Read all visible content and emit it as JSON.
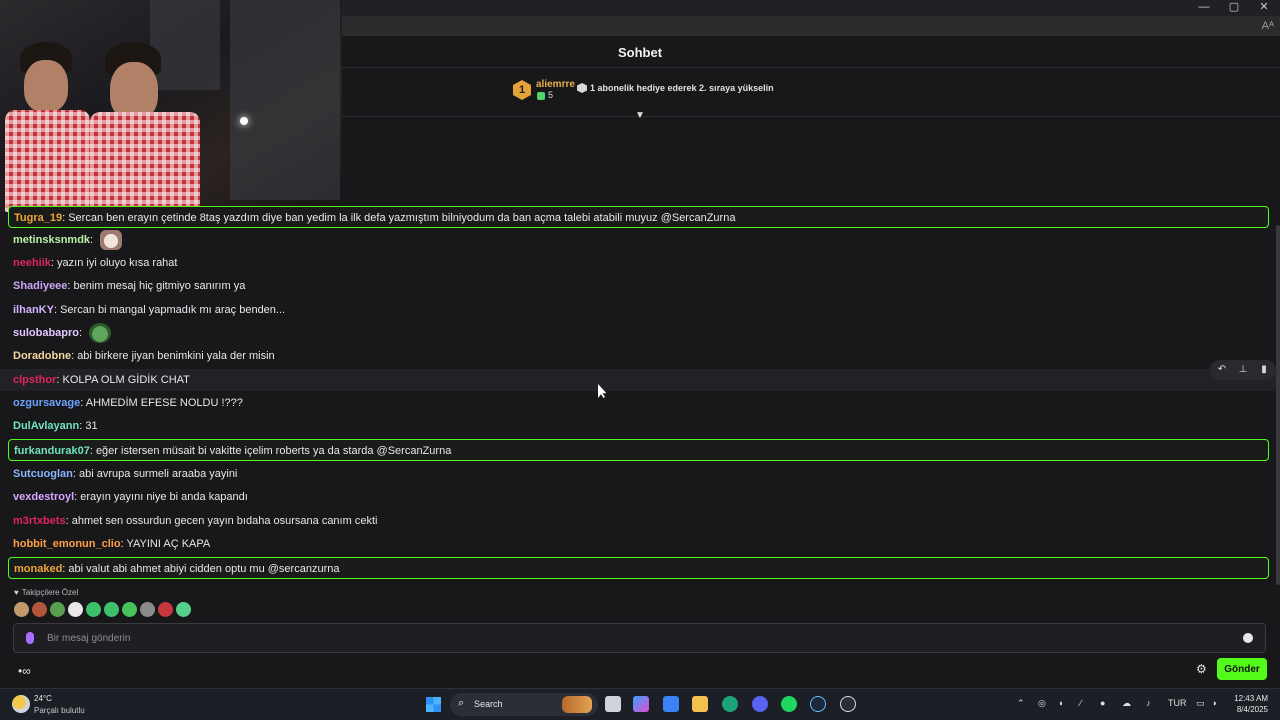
{
  "window": {
    "minimize": "—",
    "maximize": "▢",
    "close": "✕",
    "reader_icon": "reader-mode-icon",
    "reader_label": "Aᴬ"
  },
  "chat": {
    "title": "Sohbet",
    "leaderboard": {
      "rank": "1",
      "username": "aliemrre",
      "count": "5",
      "gift_text": "1 abonelik hediye ederek 2. sıraya yükselin"
    },
    "messages": [
      {
        "user": "Tugra_19",
        "color": "#f0a33c",
        "text": "Sercan ben erayın çetinde 8taş yazdım diye ban yedim la ilk defa yazmıştım bilniyodum da ban açma talebi atabili muyuz @SercanZurna",
        "highlight": true
      },
      {
        "user": "metinsksnmdk",
        "color": "#b7f2a6",
        "text": "",
        "emote": "cat-emote"
      },
      {
        "user": "neehiik",
        "color": "#e0245e",
        "text": "yazın iyi oluyo kısa rahat"
      },
      {
        "user": "Shadiyeee",
        "color": "#cba6f7",
        "text": "benim mesaj hiç gitmiyo sanırım ya"
      },
      {
        "user": "ilhanKY",
        "color": "#d4b3ff",
        "text": "Sercan bi mangal yapmadık mı araç benden..."
      },
      {
        "user": "sulobabapro",
        "color": "#e3c7ff",
        "text": "",
        "emote": "frog-emote"
      },
      {
        "user": "Doradobne",
        "color": "#f3d79b",
        "text": "abi birkere jiyan benimkini yala der misin"
      },
      {
        "user": "clpsthor",
        "color": "#e0245e",
        "text": "KOLPA OLM GİDİK CHAT",
        "hover": true
      },
      {
        "user": "ozgursavage",
        "color": "#6ba4ff",
        "text": "AHMEDİM EFESE NOLDU !???"
      },
      {
        "user": "DulAvlayann",
        "color": "#72e3c0",
        "text": "31"
      },
      {
        "user": "furkandurak07",
        "color": "#72e3c0",
        "text": "eğer istersen müsait bi vakitte içelim roberts ya da starda @SercanZurna",
        "highlight": true
      },
      {
        "user": "Sutcuoglan",
        "color": "#8ab4ff",
        "text": "abi avrupa surmeli araaba yayini"
      },
      {
        "user": "vexdestroyl",
        "color": "#d9a6ff",
        "text": "erayın yayını niye bi anda kapandı"
      },
      {
        "user": "m3rtxbets",
        "color": "#e0245e",
        "text": "ahmet sen ossurdun gecen yayın bıdaha osursana canım cekti"
      },
      {
        "user": "hobbit_emonun_clio",
        "color": "#ff9f45",
        "text": "YAYINI AÇ KAPA"
      },
      {
        "user": "monaked",
        "color": "#f0a33c",
        "text": "abi valut abi ahmet abiyi cidden optu mu @sercanzurna",
        "highlight": true
      }
    ],
    "followers_label": "Takipçilere Özel",
    "emote_colors": [
      "#c49a6c",
      "#b4553b",
      "#58a04f",
      "#e8e8e8",
      "#3fc06a",
      "#3fc06a",
      "#46c35a",
      "#8b8b8b",
      "#c6383e",
      "#56d08a"
    ],
    "input_placeholder": "Bir mesaj gönderin",
    "send_label": "Gönder",
    "points_label": "•∞"
  },
  "taskbar": {
    "weather_temp": "24°C",
    "weather_desc": "Parçalı bulutlu",
    "search_label": "Search",
    "lang": "TUR",
    "time": "12:43 AM",
    "date": "8/4/2025"
  }
}
